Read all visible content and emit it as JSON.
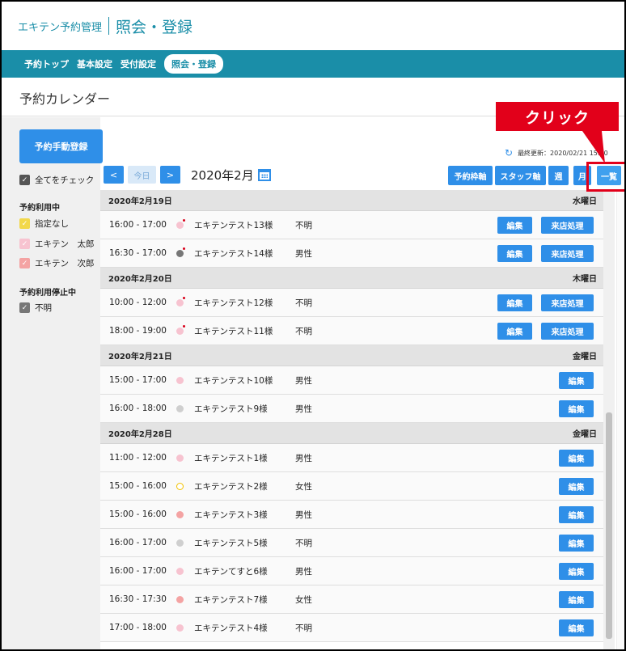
{
  "header": {
    "app_title": "エキテン予約管理",
    "page_heading": "照会・登録"
  },
  "nav": [
    {
      "label": "予約トップ",
      "active": false
    },
    {
      "label": "基本設定",
      "active": false
    },
    {
      "label": "受付設定",
      "active": false
    },
    {
      "label": "照会・登録",
      "active": true
    }
  ],
  "section_title": "予約カレンダー",
  "sidebar": {
    "manual_register_label": "予約手動登録",
    "check_all_label": "全てをチェック",
    "active_title": "予約利用中",
    "active_items": [
      {
        "label": "指定なし",
        "color": "#f2d84a"
      },
      {
        "label": "エキテン　太郎",
        "color": "#f7c3d0"
      },
      {
        "label": "エキテン　次郎",
        "color": "#f4a3a3"
      }
    ],
    "stopped_title": "予約利用停止中",
    "stopped_items": [
      {
        "label": "不明",
        "color": "#777777"
      }
    ]
  },
  "toolbar": {
    "last_updated": "最終更新：2020/02/21 15:00",
    "prev_label": "<",
    "today_label": "今日",
    "next_label": ">",
    "month_label": "2020年2月",
    "views": [
      "予約枠軸",
      "スタッフ軸",
      "週",
      "月",
      "一覧"
    ]
  },
  "annotation": {
    "label": "クリック"
  },
  "actions": {
    "edit_label": "編集",
    "visit_label": "来店処理"
  },
  "list": [
    {
      "date": "2020年2月19日",
      "weekday": "水曜日",
      "rows": [
        {
          "time": "16:00 - 17:00",
          "name": "エキテンテスト13様",
          "gender": "不明",
          "dot": "pink",
          "mark": true,
          "visit": true
        },
        {
          "time": "16:30 - 17:00",
          "name": "エキテンテスト14様",
          "gender": "男性",
          "dot": "gray",
          "mark": true,
          "visit": true
        }
      ]
    },
    {
      "date": "2020年2月20日",
      "weekday": "木曜日",
      "rows": [
        {
          "time": "10:00 - 12:00",
          "name": "エキテンテスト12様",
          "gender": "不明",
          "dot": "pink",
          "mark": true,
          "visit": true
        },
        {
          "time": "18:00 - 19:00",
          "name": "エキテンテスト11様",
          "gender": "不明",
          "dot": "pink",
          "mark": true,
          "visit": true
        }
      ]
    },
    {
      "date": "2020年2月21日",
      "weekday": "金曜日",
      "rows": [
        {
          "time": "15:00 - 17:00",
          "name": "エキテンテスト10様",
          "gender": "男性",
          "dot": "pink",
          "mark": false,
          "visit": false
        },
        {
          "time": "16:00 - 18:00",
          "name": "エキテンテスト9様",
          "gender": "男性",
          "dot": "lightgray",
          "mark": false,
          "visit": false
        }
      ]
    },
    {
      "date": "2020年2月28日",
      "weekday": "金曜日",
      "rows": [
        {
          "time": "11:00 - 12:00",
          "name": "エキテンテスト1様",
          "gender": "男性",
          "dot": "pink",
          "mark": false,
          "visit": false
        },
        {
          "time": "15:00 - 16:00",
          "name": "エキテンテスト2様",
          "gender": "女性",
          "dot": "yellow-ring",
          "mark": false,
          "visit": false
        },
        {
          "time": "15:00 - 16:00",
          "name": "エキテンテスト3様",
          "gender": "男性",
          "dot": "salmon",
          "mark": false,
          "visit": false
        },
        {
          "time": "16:00 - 17:00",
          "name": "エキテンテスト5様",
          "gender": "不明",
          "dot": "lightgray",
          "mark": false,
          "visit": false
        },
        {
          "time": "16:00 - 17:00",
          "name": "エキテンてすと6様",
          "gender": "男性",
          "dot": "pink",
          "mark": false,
          "visit": false
        },
        {
          "time": "16:30 - 17:30",
          "name": "エキテンテスト7様",
          "gender": "女性",
          "dot": "salmon",
          "mark": false,
          "visit": false
        },
        {
          "time": "17:00 - 18:00",
          "name": "エキテンテスト4様",
          "gender": "不明",
          "dot": "pink",
          "mark": false,
          "visit": false
        }
      ]
    }
  ],
  "colors": {
    "brand": "#1a8ea8",
    "button": "#2f8fe8",
    "annotation": "#e2001a",
    "dot_pink": "#f7c3d0",
    "dot_gray": "#777777",
    "dot_lightgray": "#cfcfcf",
    "dot_salmon": "#f4a3a3",
    "dot_yellow": "#f2c200"
  }
}
